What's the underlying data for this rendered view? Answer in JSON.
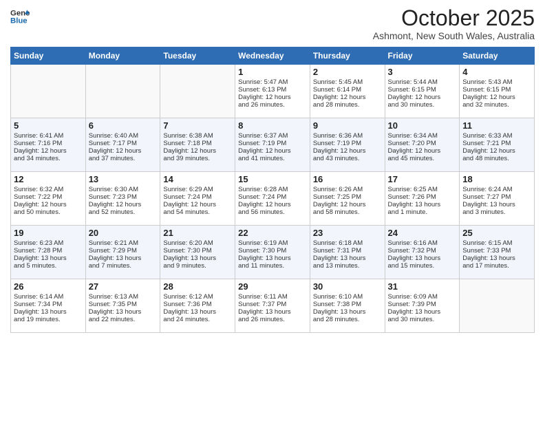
{
  "header": {
    "logo_line1": "General",
    "logo_line2": "Blue",
    "month": "October 2025",
    "location": "Ashmont, New South Wales, Australia"
  },
  "days_of_week": [
    "Sunday",
    "Monday",
    "Tuesday",
    "Wednesday",
    "Thursday",
    "Friday",
    "Saturday"
  ],
  "weeks": [
    [
      {
        "day": "",
        "info": ""
      },
      {
        "day": "",
        "info": ""
      },
      {
        "day": "",
        "info": ""
      },
      {
        "day": "1",
        "info": "Sunrise: 5:47 AM\nSunset: 6:13 PM\nDaylight: 12 hours\nand 26 minutes."
      },
      {
        "day": "2",
        "info": "Sunrise: 5:45 AM\nSunset: 6:14 PM\nDaylight: 12 hours\nand 28 minutes."
      },
      {
        "day": "3",
        "info": "Sunrise: 5:44 AM\nSunset: 6:15 PM\nDaylight: 12 hours\nand 30 minutes."
      },
      {
        "day": "4",
        "info": "Sunrise: 5:43 AM\nSunset: 6:15 PM\nDaylight: 12 hours\nand 32 minutes."
      }
    ],
    [
      {
        "day": "5",
        "info": "Sunrise: 6:41 AM\nSunset: 7:16 PM\nDaylight: 12 hours\nand 34 minutes."
      },
      {
        "day": "6",
        "info": "Sunrise: 6:40 AM\nSunset: 7:17 PM\nDaylight: 12 hours\nand 37 minutes."
      },
      {
        "day": "7",
        "info": "Sunrise: 6:38 AM\nSunset: 7:18 PM\nDaylight: 12 hours\nand 39 minutes."
      },
      {
        "day": "8",
        "info": "Sunrise: 6:37 AM\nSunset: 7:19 PM\nDaylight: 12 hours\nand 41 minutes."
      },
      {
        "day": "9",
        "info": "Sunrise: 6:36 AM\nSunset: 7:19 PM\nDaylight: 12 hours\nand 43 minutes."
      },
      {
        "day": "10",
        "info": "Sunrise: 6:34 AM\nSunset: 7:20 PM\nDaylight: 12 hours\nand 45 minutes."
      },
      {
        "day": "11",
        "info": "Sunrise: 6:33 AM\nSunset: 7:21 PM\nDaylight: 12 hours\nand 48 minutes."
      }
    ],
    [
      {
        "day": "12",
        "info": "Sunrise: 6:32 AM\nSunset: 7:22 PM\nDaylight: 12 hours\nand 50 minutes."
      },
      {
        "day": "13",
        "info": "Sunrise: 6:30 AM\nSunset: 7:23 PM\nDaylight: 12 hours\nand 52 minutes."
      },
      {
        "day": "14",
        "info": "Sunrise: 6:29 AM\nSunset: 7:24 PM\nDaylight: 12 hours\nand 54 minutes."
      },
      {
        "day": "15",
        "info": "Sunrise: 6:28 AM\nSunset: 7:24 PM\nDaylight: 12 hours\nand 56 minutes."
      },
      {
        "day": "16",
        "info": "Sunrise: 6:26 AM\nSunset: 7:25 PM\nDaylight: 12 hours\nand 58 minutes."
      },
      {
        "day": "17",
        "info": "Sunrise: 6:25 AM\nSunset: 7:26 PM\nDaylight: 13 hours\nand 1 minute."
      },
      {
        "day": "18",
        "info": "Sunrise: 6:24 AM\nSunset: 7:27 PM\nDaylight: 13 hours\nand 3 minutes."
      }
    ],
    [
      {
        "day": "19",
        "info": "Sunrise: 6:23 AM\nSunset: 7:28 PM\nDaylight: 13 hours\nand 5 minutes."
      },
      {
        "day": "20",
        "info": "Sunrise: 6:21 AM\nSunset: 7:29 PM\nDaylight: 13 hours\nand 7 minutes."
      },
      {
        "day": "21",
        "info": "Sunrise: 6:20 AM\nSunset: 7:30 PM\nDaylight: 13 hours\nand 9 minutes."
      },
      {
        "day": "22",
        "info": "Sunrise: 6:19 AM\nSunset: 7:30 PM\nDaylight: 13 hours\nand 11 minutes."
      },
      {
        "day": "23",
        "info": "Sunrise: 6:18 AM\nSunset: 7:31 PM\nDaylight: 13 hours\nand 13 minutes."
      },
      {
        "day": "24",
        "info": "Sunrise: 6:16 AM\nSunset: 7:32 PM\nDaylight: 13 hours\nand 15 minutes."
      },
      {
        "day": "25",
        "info": "Sunrise: 6:15 AM\nSunset: 7:33 PM\nDaylight: 13 hours\nand 17 minutes."
      }
    ],
    [
      {
        "day": "26",
        "info": "Sunrise: 6:14 AM\nSunset: 7:34 PM\nDaylight: 13 hours\nand 19 minutes."
      },
      {
        "day": "27",
        "info": "Sunrise: 6:13 AM\nSunset: 7:35 PM\nDaylight: 13 hours\nand 22 minutes."
      },
      {
        "day": "28",
        "info": "Sunrise: 6:12 AM\nSunset: 7:36 PM\nDaylight: 13 hours\nand 24 minutes."
      },
      {
        "day": "29",
        "info": "Sunrise: 6:11 AM\nSunset: 7:37 PM\nDaylight: 13 hours\nand 26 minutes."
      },
      {
        "day": "30",
        "info": "Sunrise: 6:10 AM\nSunset: 7:38 PM\nDaylight: 13 hours\nand 28 minutes."
      },
      {
        "day": "31",
        "info": "Sunrise: 6:09 AM\nSunset: 7:39 PM\nDaylight: 13 hours\nand 30 minutes."
      },
      {
        "day": "",
        "info": ""
      }
    ]
  ]
}
